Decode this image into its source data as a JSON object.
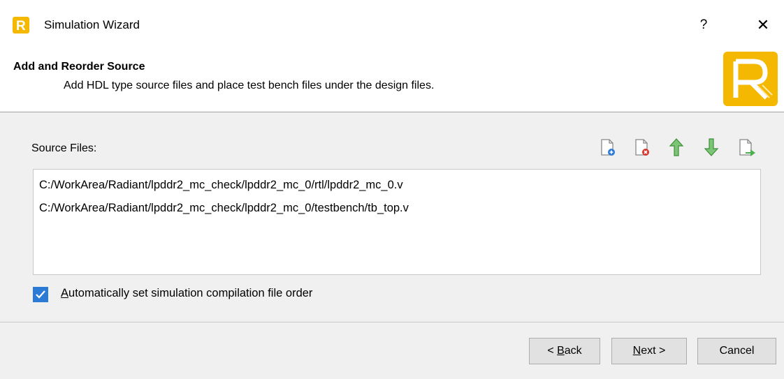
{
  "window": {
    "title": "Simulation Wizard",
    "help_label": "?",
    "close_label": "✕"
  },
  "header": {
    "title": "Add and Reorder Source",
    "subtitle": "Add HDL type source files and place test bench files under the design files."
  },
  "source_files": {
    "label": "Source Files:",
    "toolbar": [
      {
        "icon": "add-file-icon"
      },
      {
        "icon": "remove-file-icon"
      },
      {
        "icon": "move-up-arrow-icon"
      },
      {
        "icon": "move-down-arrow-icon"
      },
      {
        "icon": "import-file-icon"
      }
    ],
    "items": [
      "C:/WorkArea/Radiant/lpddr2_mc_check/lpddr2_mc_0/rtl/lpddr2_mc_0.v",
      "C:/WorkArea/Radiant/lpddr2_mc_check/lpddr2_mc_0/testbench/tb_top.v"
    ]
  },
  "auto_order": {
    "checked": true,
    "label_mnemonic": "A",
    "label_rest": "utomatically set simulation compilation file order"
  },
  "buttons": {
    "back_prefix": "< ",
    "back_mnemonic": "B",
    "back_rest": "ack",
    "next_mnemonic": "N",
    "next_rest": "ext >",
    "cancel": "Cancel"
  },
  "colors": {
    "brand": "#f5b800",
    "accent": "#2b7bd6",
    "arrow_green": "#4caf50"
  }
}
